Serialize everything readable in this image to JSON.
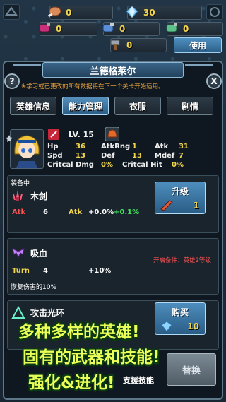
{
  "resources": {
    "row1": [
      {
        "icon": "meat-icon",
        "value": "0"
      },
      {
        "icon": "diamond-icon",
        "value": "30"
      }
    ],
    "row2": [
      {
        "icon": "potion-red-icon",
        "value": "0"
      },
      {
        "icon": "potion-blue-icon",
        "value": "0"
      },
      {
        "icon": "scroll-icon",
        "value": "0"
      },
      {
        "icon": "potion-green-icon",
        "value": "0"
      }
    ],
    "row3": [
      {
        "icon": "hammer-icon",
        "value": "0"
      }
    ],
    "use_label": "使用"
  },
  "panel": {
    "title": "兰德格莱尔",
    "help": "?",
    "close": "X",
    "notice": "※学习或已更改的所有数据将在下一个关卡开始适用。",
    "tabs": [
      "英雄信息",
      "能力管理",
      "衣服",
      "剧情"
    ],
    "active_tab": 1
  },
  "hero": {
    "level": "LV. 15",
    "stats": {
      "hp_label": "Hp",
      "hp": "36",
      "atkrng_label": "AtkRng",
      "atkrng": "1",
      "atk_label": "Atk",
      "atk": "31",
      "spd_label": "Spd",
      "spd": "13",
      "def_label": "Def",
      "def": "13",
      "mdef_label": "Mdef",
      "mdef": "7",
      "critdmg_label": "Critcal Dmg",
      "critdmg": "0%",
      "crithit_label": "Critcal Hit",
      "crithit": "0%"
    }
  },
  "equipped": {
    "header": "装备中",
    "name": "木剑",
    "atk_label": "Atk",
    "atk_value": "6",
    "bonus_label": "Atk",
    "bonus_1": "+0.0%",
    "bonus_2": "+0.1%",
    "upgrade_label": "升级",
    "upgrade_count": "1"
  },
  "skill": {
    "name": "吸血",
    "unlock": "开启条件：英雄2等级",
    "turn_label": "Turn",
    "turn_value": "4",
    "effect": "+10%",
    "desc": "恢复伤害的10%"
  },
  "aura": {
    "name": "攻击光环",
    "buy_label": "购买",
    "buy_cost": "10"
  },
  "bottom": {
    "support_label": "支援技能",
    "replace_label": "替换"
  },
  "promo": {
    "line1": "多种多样的英雄!",
    "line2": "固有的武器和技能!",
    "line3": "强化&进化!"
  },
  "colors": {
    "gold": "#f4d64b",
    "accent_blue": "#3a7cb0",
    "warning_orange": "#e8a33c",
    "red": "#ff5252",
    "green": "#3ee05a",
    "promo_yellow": "#eaff58"
  }
}
